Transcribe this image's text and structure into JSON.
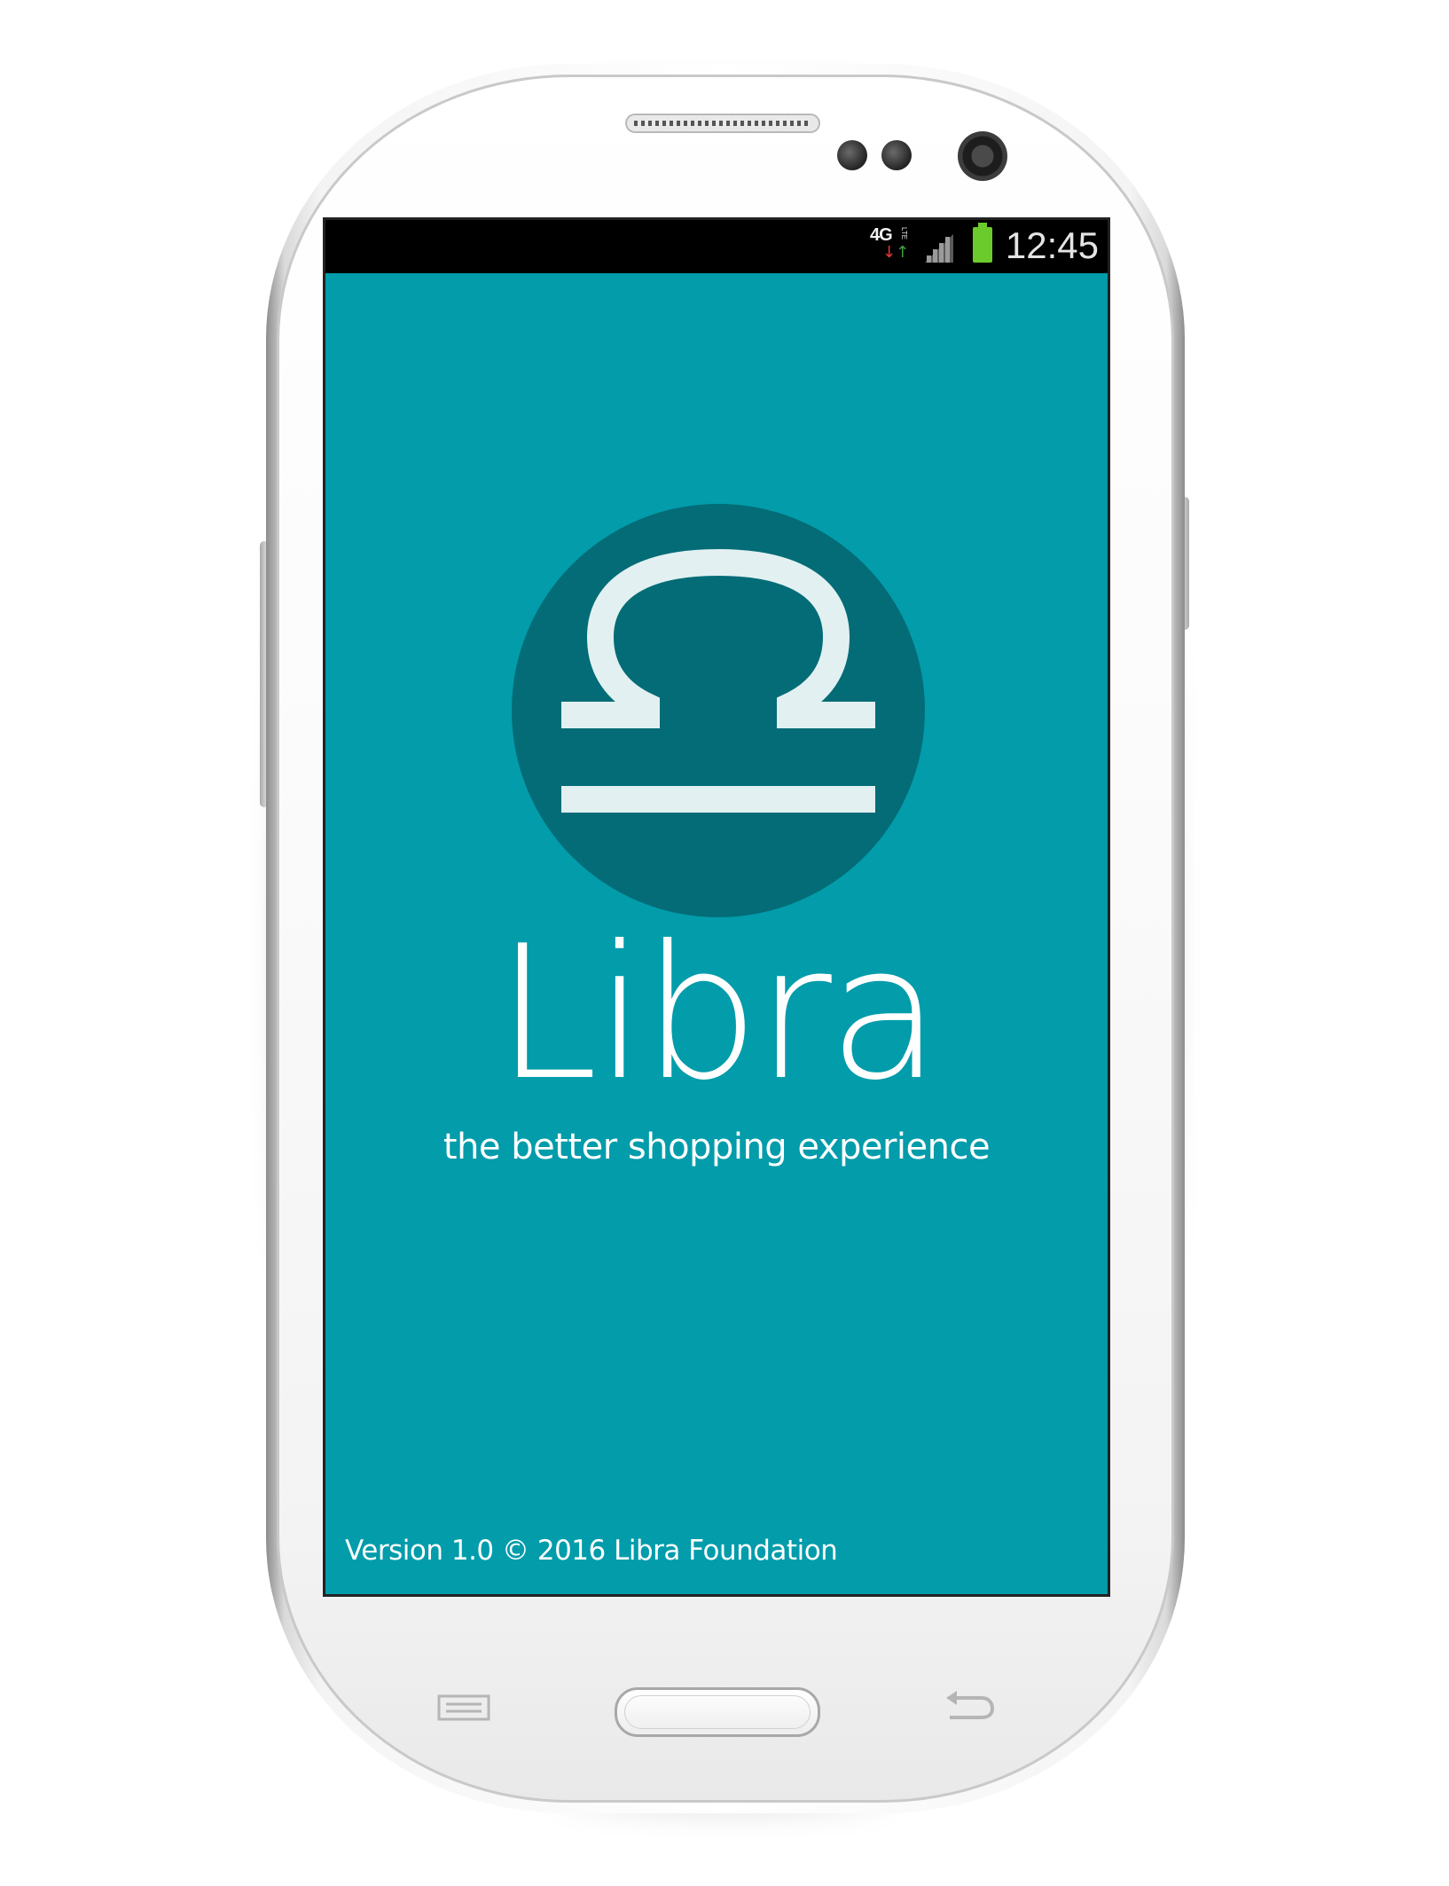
{
  "status_bar": {
    "network": "4G",
    "network_sub": "LTE",
    "clock": "12:45"
  },
  "app": {
    "name": "Libra",
    "tagline": "the better shopping experience",
    "version_text": "Version 1.0 © 2016 Libra Foundation"
  },
  "colors": {
    "screen_background": "#029cab",
    "logo_circle": "#036c76",
    "logo_symbol": "#e2f0f2",
    "text": "#ffffff",
    "status_bar": "#000000",
    "battery": "#6ccb2c"
  },
  "icons": {
    "status_signal": "signal-icon",
    "status_battery": "battery-icon",
    "logo": "libra-symbol-icon",
    "hw_menu": "menu-icon",
    "hw_back": "back-icon"
  }
}
